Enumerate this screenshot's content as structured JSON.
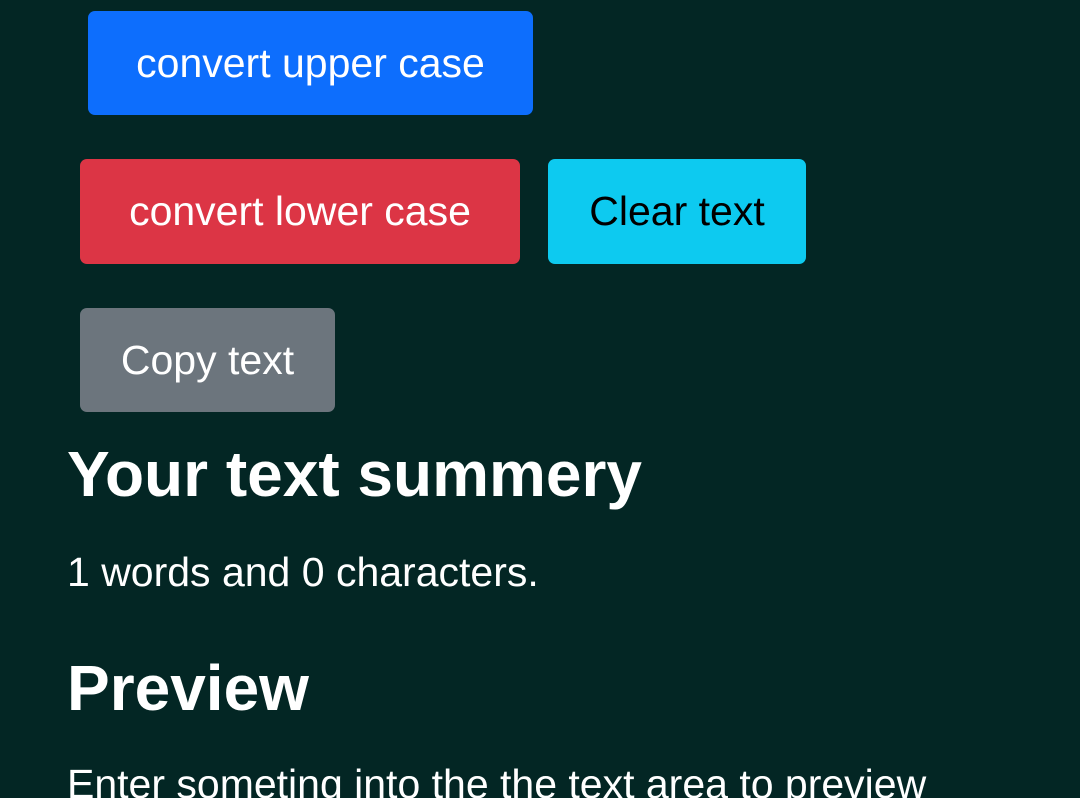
{
  "buttons": {
    "upper_label": "convert upper case",
    "lower_label": "convert lower case",
    "clear_label": "Clear text",
    "copy_label": "Copy text"
  },
  "summary": {
    "title": "Your text summery",
    "text": "1 words and 0 characters."
  },
  "preview": {
    "title": "Preview",
    "text": "Enter someting into the the text area to preview"
  },
  "colors": {
    "background": "#032624",
    "primary": "#0d6efd",
    "danger": "#dc3545",
    "info": "#0dcaf0",
    "secondary": "#6c757d"
  }
}
